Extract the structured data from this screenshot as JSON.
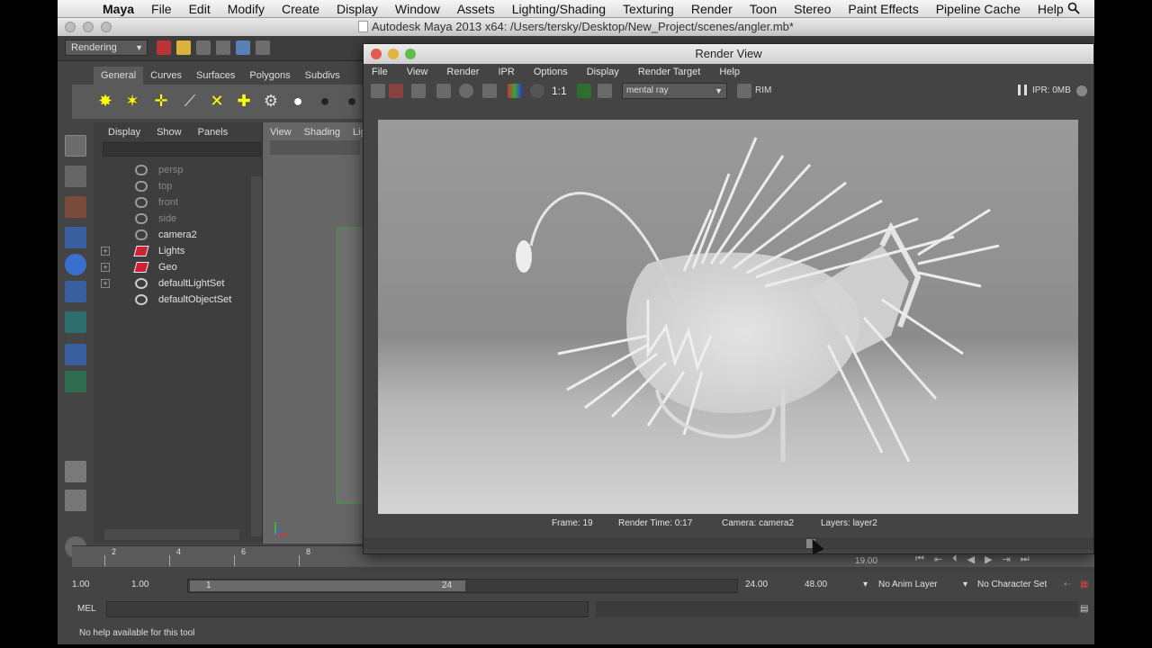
{
  "macbar": {
    "app": "Maya",
    "menus": [
      "File",
      "Edit",
      "Modify",
      "Create",
      "Display",
      "Window",
      "Assets",
      "Lighting/Shading",
      "Texturing",
      "Render",
      "Toon",
      "Stereo",
      "Paint Effects",
      "Pipeline Cache",
      "Help"
    ]
  },
  "window": {
    "title": "Autodesk Maya 2013 x64: /Users/tersky/Desktop/New_Project/scenes/angler.mb*"
  },
  "statusline": {
    "mode": "Rendering"
  },
  "shelf": {
    "tabs": [
      "General",
      "Curves",
      "Surfaces",
      "Polygons",
      "Subdivs"
    ],
    "active": "General"
  },
  "outliner": {
    "menus": [
      "Display",
      "Show",
      "Panels"
    ],
    "items": [
      {
        "name": "persp",
        "icon": "camera-icon",
        "dim": true
      },
      {
        "name": "top",
        "icon": "camera-icon",
        "dim": true
      },
      {
        "name": "front",
        "icon": "camera-icon",
        "dim": true
      },
      {
        "name": "side",
        "icon": "camera-icon",
        "dim": true
      },
      {
        "name": "camera2",
        "icon": "camera-icon",
        "dim": false
      },
      {
        "name": "Lights",
        "icon": "group-icon",
        "dim": false,
        "expandable": true
      },
      {
        "name": "Geo",
        "icon": "group-icon",
        "dim": false,
        "expandable": true
      },
      {
        "name": "defaultLightSet",
        "icon": "set-icon",
        "dim": false,
        "expandable": true
      },
      {
        "name": "defaultObjectSet",
        "icon": "set-icon",
        "dim": false
      }
    ]
  },
  "viewport": {
    "menus": [
      "View",
      "Shading",
      "Lig"
    ]
  },
  "timeslider": {
    "ticks": [
      "2",
      "4",
      "6",
      "8"
    ],
    "current_frame": "19.00"
  },
  "range": {
    "start": "1.00",
    "playback_start": "1.00",
    "handle_start": "1",
    "handle_end": "24",
    "playback_end": "24.00",
    "end": "48.00",
    "anim_layer": "No Anim Layer",
    "character_set": "No Character Set"
  },
  "mel": {
    "label": "MEL"
  },
  "help": {
    "text": "No help available for this tool"
  },
  "render_view": {
    "title": "Render View",
    "menus": [
      "File",
      "View",
      "Render",
      "IPR",
      "Options",
      "Display",
      "Render Target",
      "Help"
    ],
    "ratio": "1:1",
    "renderer": "mental ray",
    "rim": "RIM",
    "ipr": "IPR: 0MB",
    "status": {
      "frame": "Frame: 19",
      "render_time": "Render Time: 0:17",
      "camera": "Camera: camera2",
      "layers": "Layers: layer2"
    }
  }
}
